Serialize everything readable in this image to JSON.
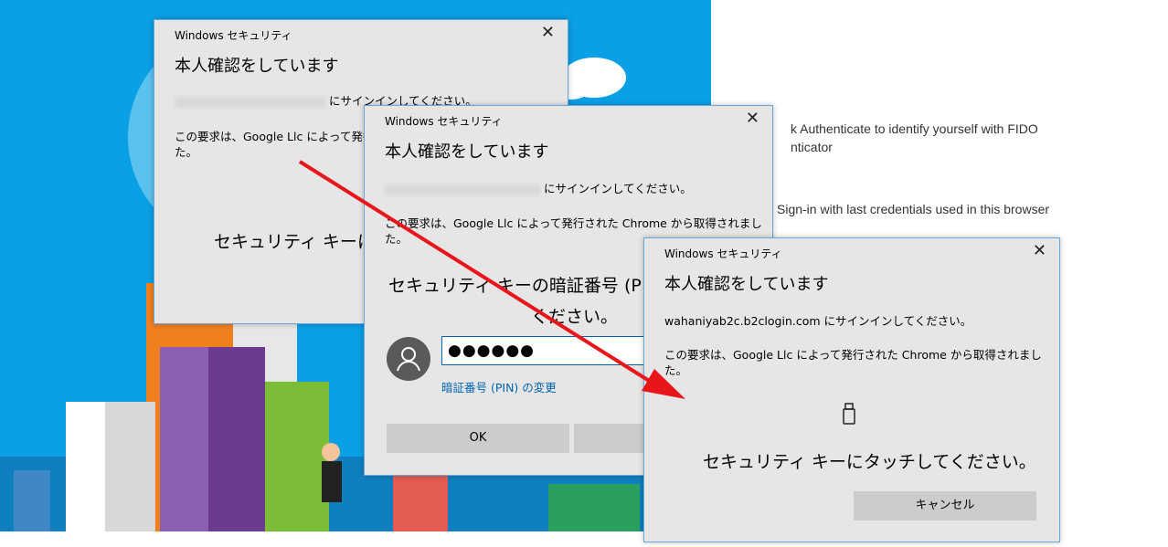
{
  "background_text": {
    "line1": "k Authenticate to identify yourself with FIDO",
    "line2": "nticator",
    "line3": "Sign-in with last credentials used in this browser"
  },
  "dialog1": {
    "title": "Windows セキュリティ",
    "heading": "本人確認をしています",
    "sign_in_suffix": "にサインインしてください。",
    "request_text": "この要求は、Google Llc によって発行",
    "request_text2": "た。",
    "instruction": "セキュリティ キーに"
  },
  "dialog2": {
    "title": "Windows セキュリティ",
    "heading": "本人確認をしています",
    "sign_in_suffix": "にサインインしてください。",
    "request_text": "この要求は、Google Llc によって発行された Chrome から取得されまし",
    "request_text2": "た。",
    "pin_prompt_line1": "セキュリティ キーの暗証番号 (P",
    "pin_prompt_line2": "ください。",
    "pin_value": "●●●●●●",
    "change_pin_link": "暗証番号 (PIN) の変更",
    "ok_label": "OK"
  },
  "dialog3": {
    "title": "Windows セキュリティ",
    "heading": "本人確認をしています",
    "sign_in_text": "wahaniyab2c.b2clogin.com にサインインしてください。",
    "request_text": "この要求は、Google Llc によって発行された Chrome から取得されまし",
    "request_text2": "た。",
    "instruction": "セキュリティ キーにタッチしてください。",
    "cancel_label": "キャンセル"
  },
  "colors": {
    "sky": "#0aa0e6",
    "dialog_bg": "#e6e6e6",
    "button_bg": "#cccccc",
    "link": "#0063b1",
    "arrow": "#e8151b"
  }
}
